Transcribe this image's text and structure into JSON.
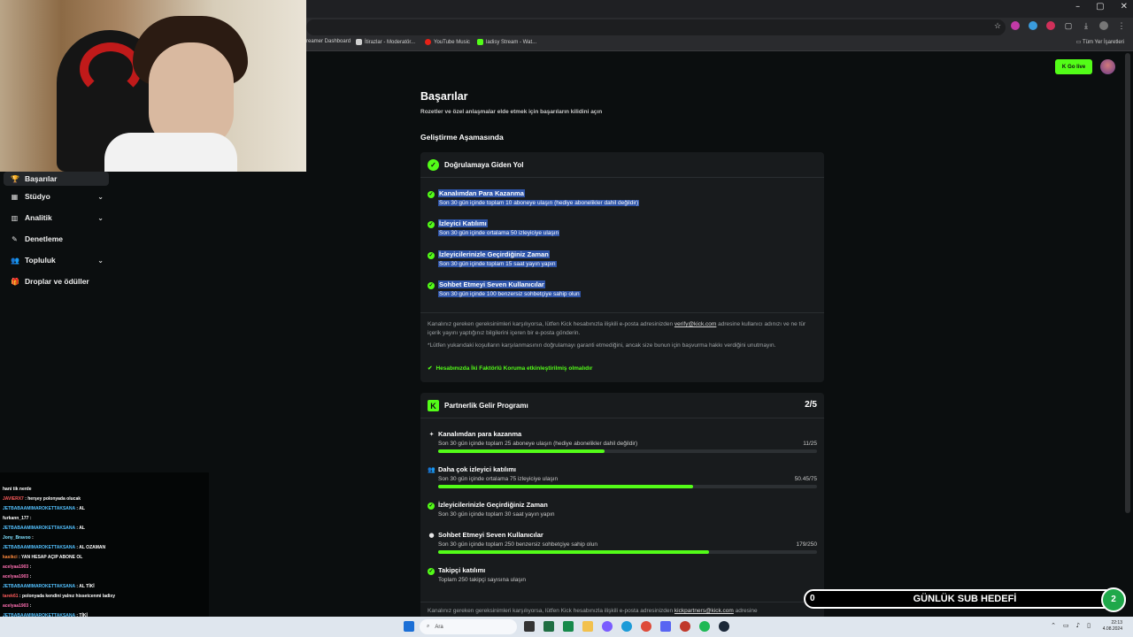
{
  "browser": {
    "window_controls": [
      "–",
      "▢",
      "✕"
    ],
    "bookmarks": [
      {
        "label": "reamer Dashboard",
        "color": "#1f1f1f"
      },
      {
        "label": "İtirazlar - Moderatör...",
        "color": "#cfcfcf"
      },
      {
        "label": "YouTube Music",
        "color": "#e62117"
      },
      {
        "label": "ladisy Stream - Wat...",
        "color": "#53fc18"
      }
    ],
    "all_bookmarks": "Tüm Yer İşaretleri"
  },
  "topbar": {
    "go_live": "Go live"
  },
  "sidebar": {
    "items": [
      {
        "label": "Başarılar",
        "icon": "trophy-icon",
        "glyph": "🏆",
        "active": true,
        "chevron": false
      },
      {
        "label": "Stüdyo",
        "icon": "studio-icon",
        "glyph": "▦",
        "active": false,
        "chevron": true
      },
      {
        "label": "Analitik",
        "icon": "chart-icon",
        "glyph": "▥",
        "active": false,
        "chevron": true
      },
      {
        "label": "Denetleme",
        "icon": "wrench-icon",
        "glyph": "✎",
        "active": false,
        "chevron": false
      },
      {
        "label": "Topluluk",
        "icon": "community-icon",
        "glyph": "👥",
        "active": false,
        "chevron": true
      },
      {
        "label": "Droplar ve ödüller",
        "icon": "gift-icon",
        "glyph": "🎁",
        "active": false,
        "chevron": false
      }
    ]
  },
  "page": {
    "title": "Başarılar",
    "subtitle": "Rozetler ve özel anlaşmalar elde etmek için başarıların kilidini açın",
    "section": "Geliştirme Aşamasında"
  },
  "verification": {
    "title": "Doğrulamaya Giden Yol",
    "requirements": [
      {
        "title": "Kanalımdan Para Kazanma",
        "desc": "Son 30 gün içinde toplam 10 aboneye ulaşın (hediye abonelikler dahil değildir)"
      },
      {
        "title": "İzleyici Katılımı",
        "desc": "Son 30 gün içinde ortalama 50 izleyiciye ulaşın"
      },
      {
        "title": "İzleyicilerinizle Geçirdiğiniz Zaman",
        "desc": "Son 30 gün içinde toplam 15 saat yayın yapın"
      },
      {
        "title": "Sohbet Etmeyi Seven Kullanıcılar",
        "desc": "Son 30 gün içinde 100 benzersiz sohbetçiye sahip olun"
      }
    ],
    "note_pre": "Kanalınız gereken gereksinimleri karşılıyorsa, lütfen Kick hesabınızla ilişkili e-posta adresinizden",
    "note_email": "verify@kick.com",
    "note_post": "adresine kullanıcı adınızı ve ne tür içerik yayını yaptığınız bilgilerini içeren bir e-posta gönderin.",
    "disclaimer": "*Lütfen yukarıdaki koşulların karşılanmasının doğrulamayı garanti etmediğini, ancak size bunun için başvurma hakkı verdiğini unutmayın.",
    "two_factor": "Hesabınızda İki Faktörlü Koruma etkinleştirilmiş olmalıdır"
  },
  "partner": {
    "title": "Partnerlik Gelir Programı",
    "score": "2/5",
    "items": [
      {
        "title": "Kanalımdan para kazanma",
        "desc": "Son 30 gün içinde toplam 25 aboneye ulaşın (hediye abonelikler dahil değildir)",
        "count": "11/25",
        "progress": 0.44,
        "icon": "sparkle-icon",
        "glyph": "✦",
        "done": false
      },
      {
        "title": "Daha çok izleyici katılımı",
        "desc": "Son 30 gün içinde ortalama 75 izleyiciye ulaşın",
        "count": "50.45/75",
        "progress": 0.673,
        "icon": "viewers-icon",
        "glyph": "👥",
        "done": false
      },
      {
        "title": "İzleyicilerinizle Geçirdiğiniz Zaman",
        "desc": "Son 30 gün içinde toplam 30 saat yayın yapın",
        "count": "",
        "progress": null,
        "icon": "check-icon",
        "glyph": "✓",
        "done": true
      },
      {
        "title": "Sohbet Etmeyi Seven Kullanıcılar",
        "desc": "Son 30 gün içinde toplam 250 benzersiz sohbetçiye sahip olun",
        "count": "179/250",
        "progress": 0.716,
        "icon": "chat-bubble-icon",
        "glyph": "●",
        "done": false
      },
      {
        "title": "Takipçi katılımı",
        "desc": "Toplam 250 takipçi sayısına ulaşın",
        "count": "",
        "progress": null,
        "icon": "check-icon",
        "glyph": "✓",
        "done": true
      }
    ],
    "note_pre": "Kanalınız gereken gereksinimleri karşılıyorsa, lütfen Kick hesabınızla ilişkili e-posta adresinizden",
    "note_email": "kickpartners@kick.com",
    "note_post": "adresine"
  },
  "chat": {
    "lines": [
      {
        "user": "",
        "text": "hani tik nerde",
        "ucolor": "#ffffff"
      },
      {
        "user": "JAVIERX7",
        "text": ": herşey polonyada olucak",
        "ucolor": "#ff5c5c"
      },
      {
        "user": "JETBABAAMIMAROKETTAKSANA",
        "text": ": AL",
        "ucolor": "#53c1ff"
      },
      {
        "user": "furkann_177",
        "text": ":",
        "ucolor": "#ffffff"
      },
      {
        "user": "JETBABAAMIMAROKETTAKSANA",
        "text": ": AL",
        "ucolor": "#53c1ff"
      },
      {
        "user": "Jony_Bravoo",
        "text": ":",
        "ucolor": "#7fe0ff"
      },
      {
        "user": "JETBABAAMIMAROKETTAKSANA",
        "text": ": AL OZAMAN",
        "ucolor": "#53c1ff"
      },
      {
        "user": "kasikci",
        "text": ": YAN HESAP AÇIP ABONE OL",
        "ucolor": "#ff8a3d"
      },
      {
        "user": "acelyaa1903",
        "text": ":",
        "ucolor": "#ff6fb1"
      },
      {
        "user": "acelyaa1903",
        "text": ":",
        "ucolor": "#ff6fb1"
      },
      {
        "user": "JETBABAAMIMAROKETTAKSANA",
        "text": ": AL TİKİ",
        "ucolor": "#53c1ff"
      },
      {
        "user": "tarek61",
        "text": ": polonyada kendini yalnız hissetcenmi ladixy",
        "ucolor": "#ff5c5c"
      },
      {
        "user": "acelyaa1903",
        "text": ":",
        "ucolor": "#ff6fb1"
      },
      {
        "user": "JETBABAAMIMAROKETTAKSANA",
        "text": ": TİKİ",
        "ucolor": "#53c1ff"
      }
    ]
  },
  "subgoal": {
    "current": "0",
    "label": "GÜNLÜK SUB HEDEFİ",
    "target": "2"
  },
  "taskbar": {
    "search_placeholder": "Ara",
    "time": "22:13",
    "date": "4.08.2024"
  }
}
